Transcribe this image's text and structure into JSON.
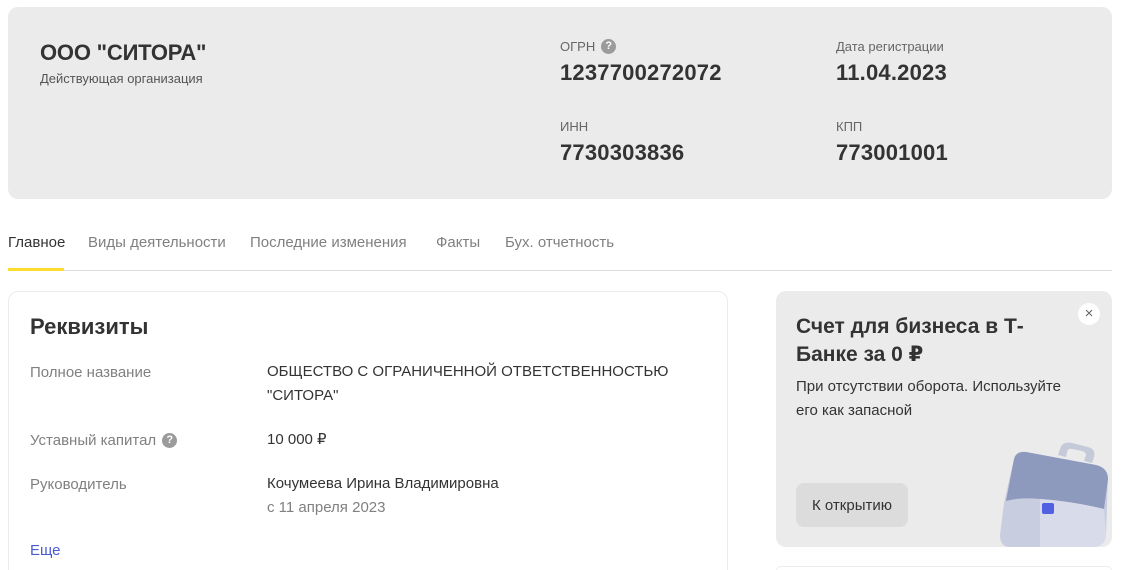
{
  "company": {
    "name": "ООО \"СИТОРА\"",
    "status": "Действующая организация"
  },
  "requisites": {
    "ogrn": {
      "label": "ОГРН",
      "value": "1237700272072"
    },
    "reg_date": {
      "label": "Дата регистрации",
      "value": "11.04.2023"
    },
    "inn": {
      "label": "ИНН",
      "value": "7730303836"
    },
    "kpp": {
      "label": "КПП",
      "value": "773001001"
    }
  },
  "tabs": [
    {
      "label": "Главное",
      "active": true
    },
    {
      "label": "Виды деятельности",
      "active": false
    },
    {
      "label": "Последние изменения",
      "active": false
    },
    {
      "label": "Факты",
      "active": false
    },
    {
      "label": "Бух. отчетность",
      "active": false
    }
  ],
  "details": {
    "title": "Реквизиты",
    "rows": [
      {
        "label": "Полное название",
        "value": "ОБЩЕСТВО С ОГРАНИЧЕННОЙ ОТВЕТСТВЕННОСТЬЮ \"СИТОРА\""
      },
      {
        "label": "Уставный капитал",
        "value": "10 000 ₽"
      },
      {
        "label": "Руководитель",
        "value": "Кочумеева Ирина Владимировна",
        "sub": "с 11 апреля 2023"
      }
    ],
    "more_label": "Еще"
  },
  "promo": {
    "title": "Счет для бизнеса в Т-Банке за 0 ₽",
    "text": "При отсутствии оборота. Используйте его как запасной",
    "button_label": "К открытию",
    "close_glyph": "×",
    "icon": "briefcase-illustration"
  },
  "icons": {
    "help_glyph": "?"
  },
  "colors": {
    "accent_underline": "#ffdd2d",
    "link": "#4a5bd6",
    "card_background": "#ebebeb"
  }
}
